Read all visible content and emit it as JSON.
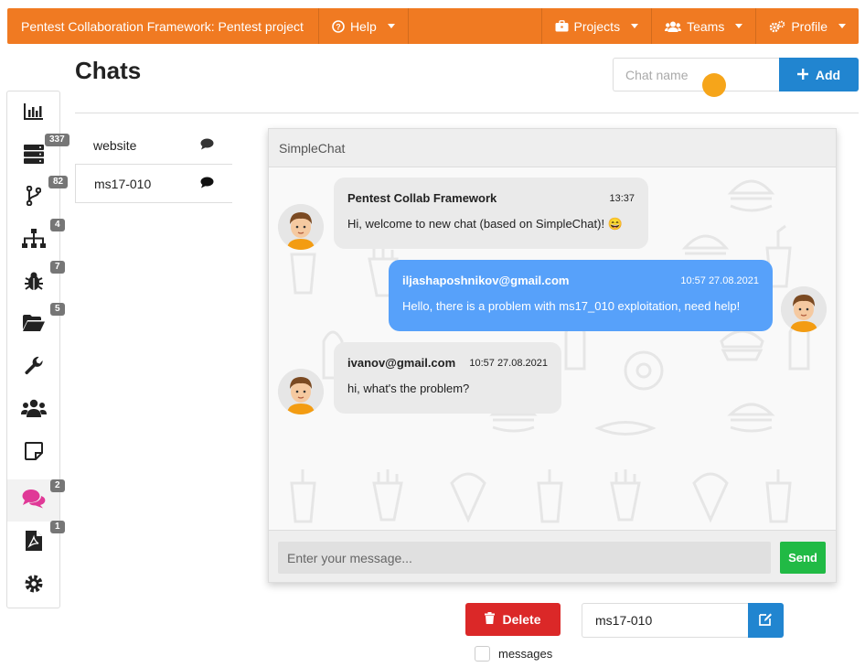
{
  "topbar": {
    "brand": "Pentest Collaboration Framework: Pentest project",
    "help": "Help",
    "projects": "Projects",
    "teams": "Teams",
    "profile": "Profile"
  },
  "page": {
    "title": "Chats",
    "chat_name_placeholder": "Chat name",
    "add_label": "Add"
  },
  "sidebar": {
    "items": [
      {
        "icon": "bar-chart-icon",
        "badge": ""
      },
      {
        "icon": "server-icon",
        "badge": "337"
      },
      {
        "icon": "branch-icon",
        "badge": "82"
      },
      {
        "icon": "network-icon",
        "badge": "4"
      },
      {
        "icon": "bug-icon",
        "badge": "7"
      },
      {
        "icon": "folder-icon",
        "badge": "5"
      },
      {
        "icon": "wrench-icon",
        "badge": ""
      },
      {
        "icon": "users-icon",
        "badge": ""
      },
      {
        "icon": "note-icon",
        "badge": ""
      },
      {
        "icon": "chat-icon",
        "badge": "2"
      },
      {
        "icon": "pdf-icon",
        "badge": "1"
      },
      {
        "icon": "settings-icon",
        "badge": ""
      }
    ]
  },
  "chat_list": {
    "items": [
      {
        "name": "website"
      },
      {
        "name": "ms17-010"
      }
    ]
  },
  "chat": {
    "header": "SimpleChat",
    "messages": [
      {
        "author": "Pentest Collab Framework",
        "time": "13:37",
        "text": "Hi, welcome to new chat (based on SimpleChat)! 😄"
      },
      {
        "author": "iljashaposhnikov@gmail.com",
        "time": "10:57 27.08.2021",
        "text": "Hello, there is a problem with ms17_010 exploitation, need help!"
      },
      {
        "author": "ivanov@gmail.com",
        "time": "10:57 27.08.2021",
        "text": "hi, what's the problem?"
      }
    ],
    "input_placeholder": "Enter your message...",
    "send_label": "Send"
  },
  "controls": {
    "delete_label": "Delete",
    "rename_value": "ms17-010",
    "messages_label": "messages"
  },
  "colors": {
    "topbar": "#f07a22",
    "primary": "#2185d0",
    "danger": "#db2828",
    "success": "#21ba45",
    "out_bubble": "#57a1fa",
    "active_icon": "#e03997"
  }
}
